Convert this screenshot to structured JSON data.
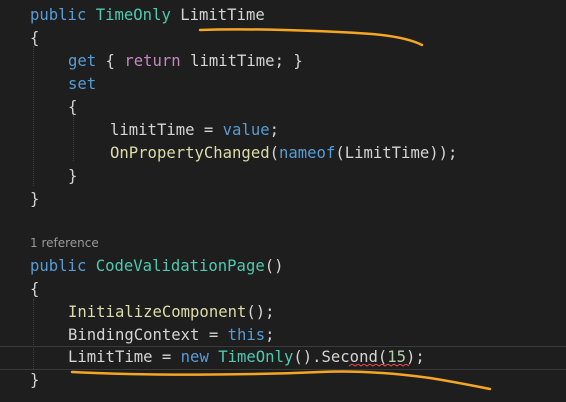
{
  "code": {
    "line1": {
      "public": "public",
      "type": "TimeOnly",
      "name": "LimitTime"
    },
    "line2": {
      "brace": "{"
    },
    "line3": {
      "get": "get",
      "ob": " { ",
      "ret": "return",
      "rest": " limitTime; }"
    },
    "line4": {
      "set": "set"
    },
    "line5": {
      "brace": "{"
    },
    "line6": {
      "field": "limitTime",
      "eq": " = ",
      "value": "value",
      "semi": ";"
    },
    "line7": {
      "fn": "OnPropertyChanged",
      "p1": "(",
      "nameof": "nameof",
      "arg": "(LimitTime));"
    },
    "line8": {
      "brace": "}"
    },
    "line9": {
      "brace": "}"
    },
    "lens": "1 reference",
    "line10": {
      "public": "public",
      "ctor": "CodeValidationPage",
      "parens": "()"
    },
    "line11": {
      "brace": "{"
    },
    "line12": {
      "fn": "InitializeComponent",
      "rest": "();"
    },
    "line13": {
      "prop": "BindingContext",
      "eq": " = ",
      "this": "this",
      "semi": ";"
    },
    "line14": {
      "prop": "LimitTime",
      "eq": " = ",
      "new": "new",
      "type": "TimeOnly",
      "mid": "().",
      "member": "Second",
      "open": "(",
      "num": "15",
      "close": ");"
    },
    "line15": {
      "brace": "}"
    }
  },
  "colors": {
    "keyword": "#569cd6",
    "control_keyword": "#c586c0",
    "type": "#4ec9b0",
    "function": "#dcdcaa",
    "variable": "#9cdcfe",
    "number": "#b5cea8",
    "annotation": "#f5a623",
    "error_squiggle": "#f14c4c"
  }
}
